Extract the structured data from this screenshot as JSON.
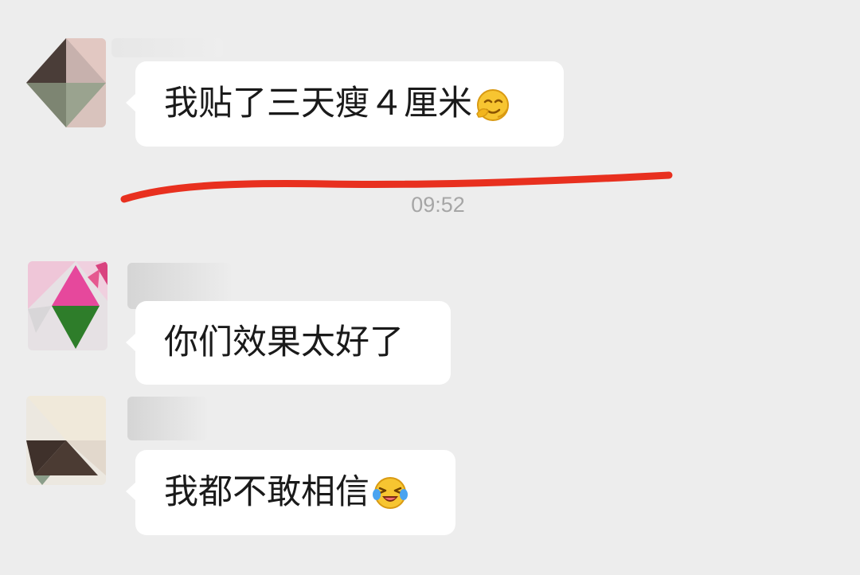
{
  "chat": {
    "timestamp": "09:52",
    "messages": [
      {
        "text": "我贴了三天瘦４厘米",
        "emoji_icon": "smiling-face-emoji"
      },
      {
        "text": "你们效果太好了"
      },
      {
        "text": "我都不敢相信",
        "emoji_icon": "laughing-crying-face-emoji"
      }
    ]
  },
  "colors": {
    "background": "#ededed",
    "bubble": "#ffffff",
    "timestamp": "#a6a6a6",
    "annotation_underline": "#e8301f"
  }
}
